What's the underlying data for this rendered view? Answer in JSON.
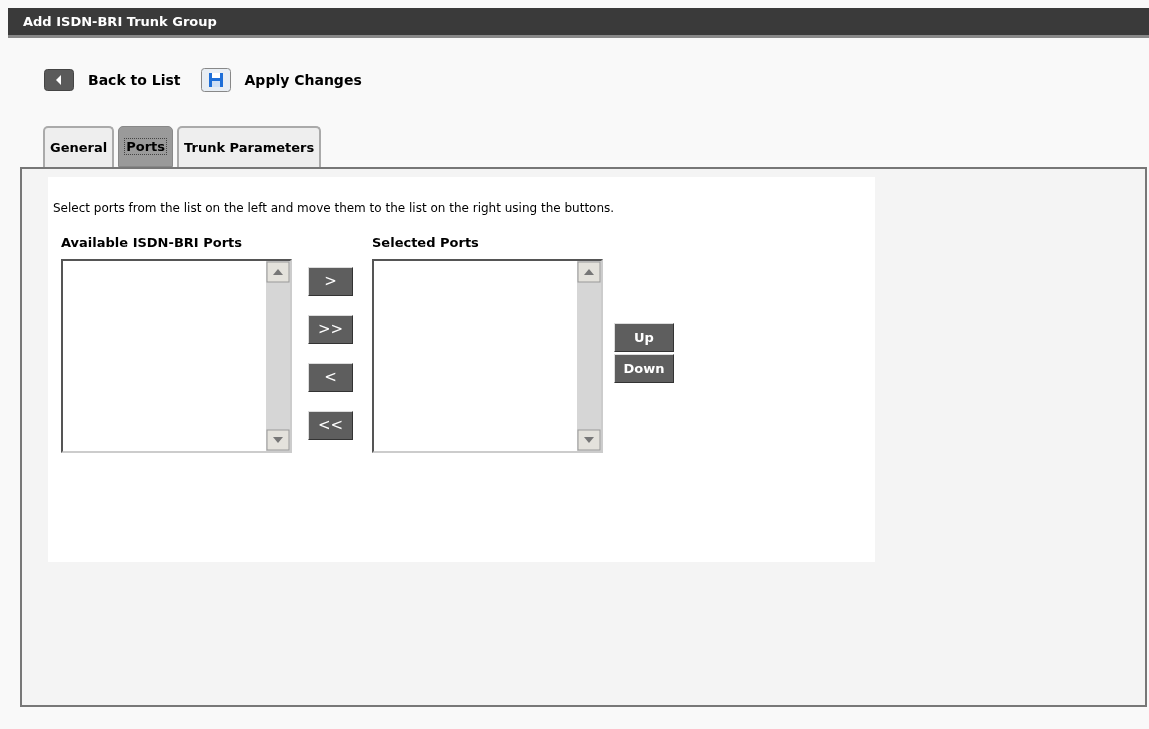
{
  "window": {
    "title": "Add ISDN-BRI Trunk Group"
  },
  "toolbar": [
    {
      "kind": "back",
      "label": "Back to List"
    },
    {
      "kind": "save",
      "label": "Apply Changes"
    }
  ],
  "tabs": [
    {
      "label": "General",
      "selected": false
    },
    {
      "label": "Ports",
      "selected": true
    },
    {
      "label": "Trunk Parameters",
      "selected": false
    }
  ],
  "instruction": "Select ports from the list on the left and move them to the list on the right using the buttons.",
  "available_list": {
    "label": "Available ISDN-BRI Ports"
  },
  "move_buttons": [
    ">",
    ">>",
    "<",
    "<<"
  ],
  "selected_list": {
    "label": "Selected Ports"
  },
  "order_buttons": [
    "Up",
    "Down"
  ]
}
